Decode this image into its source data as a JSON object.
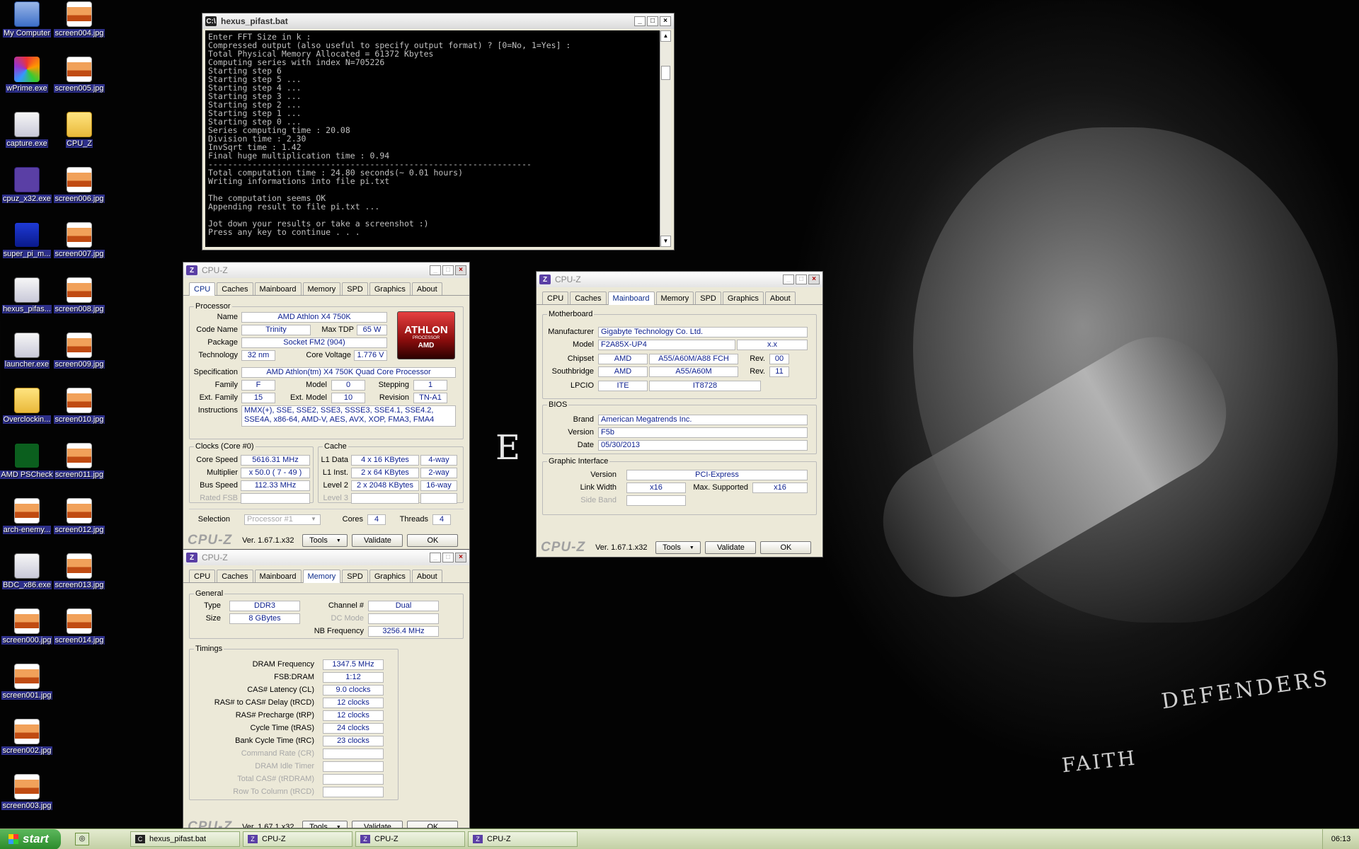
{
  "desktop": {
    "icons": [
      {
        "label": "My Computer",
        "type": "pc"
      },
      {
        "label": "screen004.jpg",
        "type": "img"
      },
      {
        "label": "wPrime.exe",
        "type": "prime"
      },
      {
        "label": "screen005.jpg",
        "type": "img"
      },
      {
        "label": "capture.exe",
        "type": "exe"
      },
      {
        "label": "CPU_Z",
        "type": "folder"
      },
      {
        "label": "cpuz_x32.exe",
        "type": "cpuz"
      },
      {
        "label": "screen006.jpg",
        "type": "img"
      },
      {
        "label": "super_pi_m...",
        "type": "super"
      },
      {
        "label": "screen007.jpg",
        "type": "img"
      },
      {
        "label": "hexus_pifas...",
        "type": "exe"
      },
      {
        "label": "screen008.jpg",
        "type": "img"
      },
      {
        "label": "launcher.exe",
        "type": "exe"
      },
      {
        "label": "screen009.jpg",
        "type": "img"
      },
      {
        "label": "Overclockin...",
        "type": "folder"
      },
      {
        "label": "screen010.jpg",
        "type": "img"
      },
      {
        "label": "AMD PSCheck",
        "type": "amd"
      },
      {
        "label": "screen011.jpg",
        "type": "img"
      },
      {
        "label": "arch-enemy...",
        "type": "img"
      },
      {
        "label": "screen012.jpg",
        "type": "img"
      },
      {
        "label": "BDC_x86.exe",
        "type": "exe"
      },
      {
        "label": "screen013.jpg",
        "type": "img"
      },
      {
        "label": "screen000.jpg",
        "type": "img"
      },
      {
        "label": "screen014.jpg",
        "type": "img"
      },
      {
        "label": "screen001.jpg",
        "type": "img"
      },
      {
        "label": "screen002.jpg",
        "type": "img"
      },
      {
        "label": "screen003.jpg",
        "type": "img"
      }
    ],
    "wallpaper_text": {
      "en": "E N",
      "defenders": "DEFENDERS",
      "faith": "FAITH"
    }
  },
  "console": {
    "title": "hexus_pifast.bat",
    "lines": [
      "Enter FFT Size in k :",
      "Compressed output (also useful to specify output format) ? [0=No, 1=Yes] :",
      "Total Physical Memory Allocated = 61372 Kbytes",
      "Computing series with index N=705226",
      "Starting step 6",
      "Starting step 5 ...",
      "Starting step 4 ...",
      "Starting step 3 ...",
      "Starting step 2 ...",
      "Starting step 1 ...",
      "Starting step 0 ...",
      "Series computing time : 20.08",
      "Division time : 2.30",
      "InvSqrt time : 1.42",
      "Final huge multiplication time : 0.94",
      "------------------------------------------------------------------",
      "Total computation time : 24.80 seconds(~ 0.01 hours)",
      "Writing informations into file pi.txt",
      "",
      "The computation seems OK",
      "Appending result to file pi.txt ...",
      "",
      "Jot down your results or take a screenshot :)",
      "Press any key to continue . . ."
    ]
  },
  "cpuz_common": {
    "title": "CPU-Z",
    "tabs": [
      "CPU",
      "Caches",
      "Mainboard",
      "Memory",
      "SPD",
      "Graphics",
      "About"
    ],
    "brand": "CPU-Z",
    "version": "Ver. 1.67.1.x32",
    "tools": "Tools",
    "validate": "Validate",
    "ok": "OK"
  },
  "cpu": {
    "group_processor": "Processor",
    "name_lbl": "Name",
    "name": "AMD Athlon X4 750K",
    "codename_lbl": "Code Name",
    "codename": "Trinity",
    "maxtdp_lbl": "Max TDP",
    "maxtdp": "65 W",
    "package_lbl": "Package",
    "package": "Socket FM2 (904)",
    "tech_lbl": "Technology",
    "tech": "32 nm",
    "corev_lbl": "Core Voltage",
    "corev": "1.776 V",
    "spec_lbl": "Specification",
    "spec": "AMD Athlon(tm) X4 750K Quad Core Processor",
    "family_lbl": "Family",
    "family": "F",
    "model_lbl": "Model",
    "model": "0",
    "stepping_lbl": "Stepping",
    "stepping": "1",
    "extfamily_lbl": "Ext. Family",
    "extfamily": "15",
    "extmodel_lbl": "Ext. Model",
    "extmodel": "10",
    "revision_lbl": "Revision",
    "revision": "TN-A1",
    "instr_lbl": "Instructions",
    "instr": "MMX(+), SSE, SSE2, SSE3, SSSE3, SSE4.1, SSE4.2, SSE4A, x86-64, AMD-V, AES, AVX, XOP, FMA3, FMA4",
    "logo_big": "ATHLON",
    "logo_small": "PROCESSOR",
    "logo_amd": "AMD",
    "group_clocks": "Clocks (Core #0)",
    "corespeed_lbl": "Core Speed",
    "corespeed": "5616.31 MHz",
    "mult_lbl": "Multiplier",
    "mult": "x 50.0 ( 7 - 49 )",
    "bus_lbl": "Bus Speed",
    "bus": "112.33 MHz",
    "fsb_lbl": "Rated FSB",
    "fsb": "",
    "group_cache": "Cache",
    "l1d_lbl": "L1 Data",
    "l1d": "4 x 16 KBytes",
    "l1d_w": "4-way",
    "l1i_lbl": "L1 Inst.",
    "l1i": "2 x 64 KBytes",
    "l1i_w": "2-way",
    "l2_lbl": "Level 2",
    "l2": "2 x 2048 KBytes",
    "l2_w": "16-way",
    "l3_lbl": "Level 3",
    "l3": "",
    "l3_w": "",
    "selection_lbl": "Selection",
    "selection": "Processor #1",
    "cores_lbl": "Cores",
    "cores": "4",
    "threads_lbl": "Threads",
    "threads": "4"
  },
  "mainboard": {
    "group_mb": "Motherboard",
    "manu_lbl": "Manufacturer",
    "manu": "Gigabyte Technology Co. Ltd.",
    "model_lbl": "Model",
    "model": "F2A85X-UP4",
    "model_rev": "x.x",
    "chipset_lbl": "Chipset",
    "chipset_vendor": "AMD",
    "chipset": "A55/A60M/A88 FCH",
    "chipset_rev_lbl": "Rev.",
    "chipset_rev": "00",
    "sb_lbl": "Southbridge",
    "sb_vendor": "AMD",
    "sb": "A55/A60M",
    "sb_rev_lbl": "Rev.",
    "sb_rev": "11",
    "lpcio_lbl": "LPCIO",
    "lpcio_vendor": "ITE",
    "lpcio": "IT8728",
    "group_bios": "BIOS",
    "brand_lbl": "Brand",
    "brand": "American Megatrends Inc.",
    "version_lbl": "Version",
    "version": "F5b",
    "date_lbl": "Date",
    "date": "05/30/2013",
    "group_gi": "Graphic Interface",
    "giver_lbl": "Version",
    "giver": "PCI-Express",
    "lw_lbl": "Link Width",
    "lw": "x16",
    "ms_lbl": "Max. Supported",
    "ms": "x16",
    "sb2_lbl": "Side Band",
    "sb2": ""
  },
  "memory": {
    "group_general": "General",
    "type_lbl": "Type",
    "type": "DDR3",
    "size_lbl": "Size",
    "size": "8 GBytes",
    "channel_lbl": "Channel #",
    "channel": "Dual",
    "dcmode_lbl": "DC Mode",
    "dcmode": "",
    "nbfreq_lbl": "NB Frequency",
    "nbfreq": "3256.4 MHz",
    "group_timings": "Timings",
    "timings": [
      {
        "lbl": "DRAM Frequency",
        "val": "1347.5 MHz",
        "dim": false
      },
      {
        "lbl": "FSB:DRAM",
        "val": "1:12",
        "dim": false
      },
      {
        "lbl": "CAS# Latency (CL)",
        "val": "9.0 clocks",
        "dim": false
      },
      {
        "lbl": "RAS# to CAS# Delay (tRCD)",
        "val": "12 clocks",
        "dim": false
      },
      {
        "lbl": "RAS# Precharge (tRP)",
        "val": "12 clocks",
        "dim": false
      },
      {
        "lbl": "Cycle Time (tRAS)",
        "val": "24 clocks",
        "dim": false
      },
      {
        "lbl": "Bank Cycle Time (tRC)",
        "val": "23 clocks",
        "dim": false
      },
      {
        "lbl": "Command Rate (CR)",
        "val": "",
        "dim": true
      },
      {
        "lbl": "DRAM Idle Timer",
        "val": "",
        "dim": true
      },
      {
        "lbl": "Total CAS# (tRDRAM)",
        "val": "",
        "dim": true
      },
      {
        "lbl": "Row To Column (tRCD)",
        "val": "",
        "dim": true
      }
    ]
  },
  "taskbar": {
    "start": "start",
    "tasks": [
      {
        "label": "hexus_pifast.bat",
        "icon": "cmd"
      },
      {
        "label": "CPU-Z",
        "icon": "cpuz"
      },
      {
        "label": "CPU-Z",
        "icon": "cpuz"
      },
      {
        "label": "CPU-Z",
        "icon": "cpuz"
      }
    ],
    "clock": "06:13"
  }
}
